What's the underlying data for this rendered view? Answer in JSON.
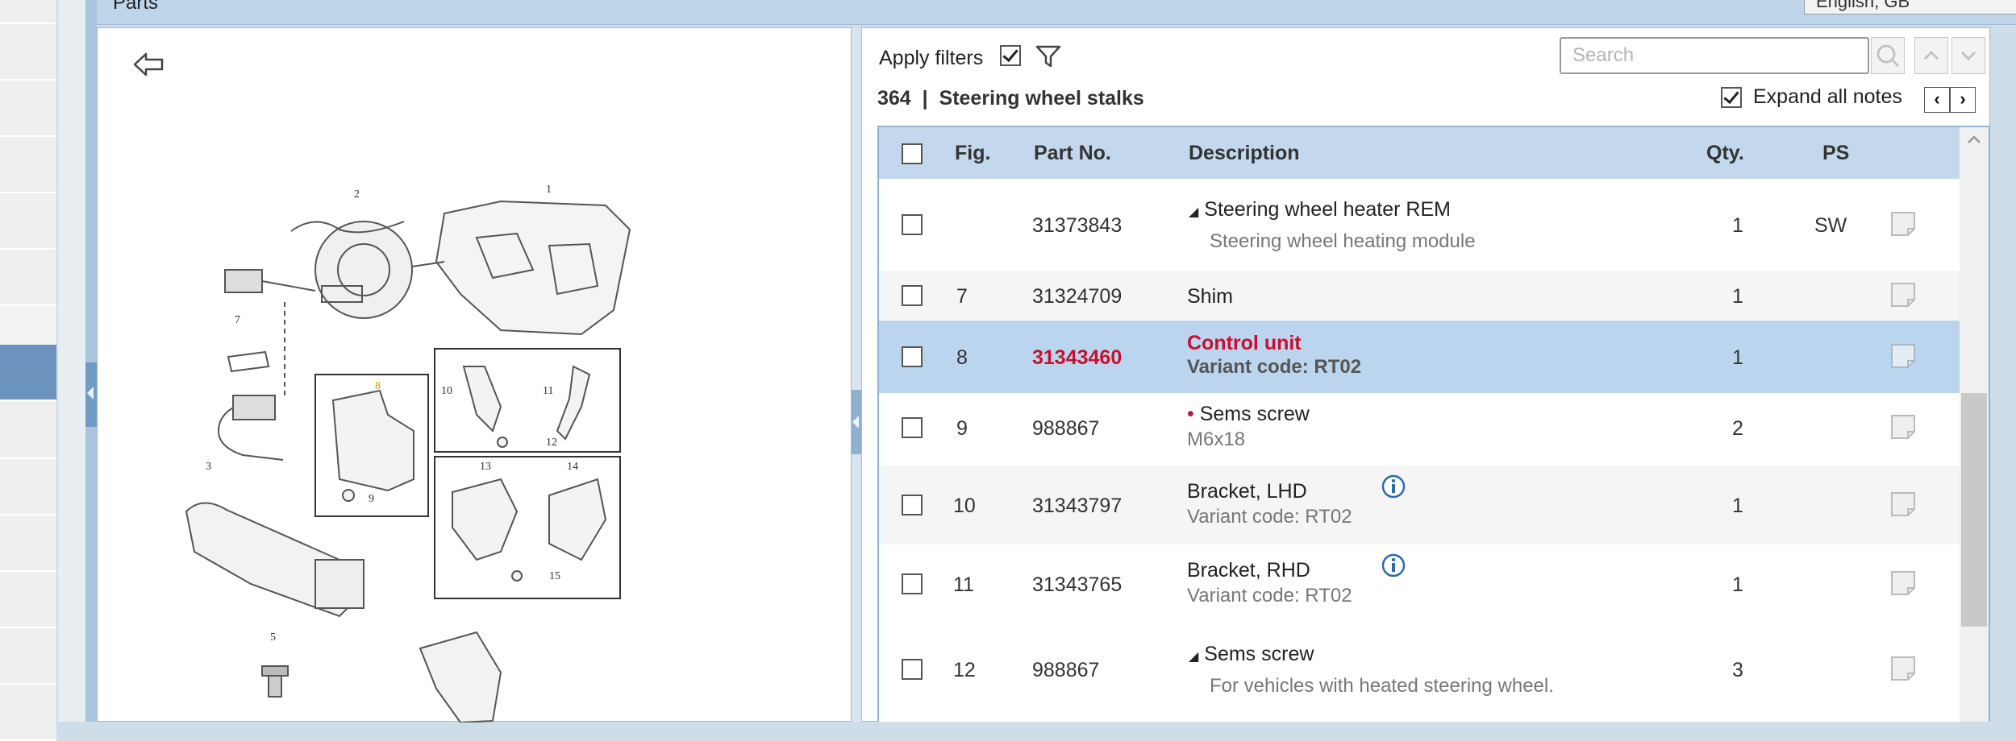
{
  "header": {
    "title": "Parts",
    "language": "English, GB"
  },
  "toolbar": {
    "apply_filters_label": "Apply filters",
    "apply_filters_checked": true,
    "search_placeholder": "Search",
    "section_number": "364",
    "section_separator": "|",
    "section_title": "Steering wheel stalks",
    "expand_all_notes_label": "Expand all notes",
    "expand_all_notes_checked": true,
    "prev_label": "‹",
    "next_label": "›"
  },
  "table": {
    "columns": {
      "fig": "Fig.",
      "part_no": "Part No.",
      "description": "Description",
      "qty": "Qty.",
      "ps": "PS"
    },
    "rows": [
      {
        "fig": "",
        "part_no": "31373843",
        "prefix": "◢",
        "description": "Steering wheel heater REM",
        "note": "Steering wheel heating module",
        "qty": "1",
        "ps": "SW"
      },
      {
        "fig": "7",
        "part_no": "31324709",
        "prefix": "",
        "description": "Shim",
        "note": "",
        "qty": "1",
        "ps": ""
      },
      {
        "fig": "8",
        "part_no": "31343460",
        "prefix": "",
        "description": "Control unit",
        "note": "Variant code: RT02",
        "qty": "1",
        "ps": "",
        "selected": true
      },
      {
        "fig": "9",
        "part_no": "988867",
        "prefix": "•",
        "description": "Sems screw",
        "note": "M6x18",
        "qty": "2",
        "ps": ""
      },
      {
        "fig": "10",
        "part_no": "31343797",
        "prefix": "",
        "description": "Bracket, LHD",
        "note": "Variant code: RT02",
        "qty": "1",
        "ps": "",
        "info": true
      },
      {
        "fig": "11",
        "part_no": "31343765",
        "prefix": "",
        "description": "Bracket, RHD",
        "note": "Variant code: RT02",
        "qty": "1",
        "ps": "",
        "info": true
      },
      {
        "fig": "12",
        "part_no": "988867",
        "prefix": "◢",
        "description": "Sems screw",
        "note": "For vehicles with heated steering wheel.",
        "qty": "3",
        "ps": ""
      }
    ]
  },
  "diagram": {
    "callouts": [
      "1",
      "2",
      "3",
      "5",
      "7",
      "8",
      "9",
      "10",
      "11",
      "12",
      "13",
      "14",
      "15"
    ]
  },
  "colors": {
    "accent": "#6b93bd",
    "selected_row": "#bcd5ee",
    "highlight_text": "#c8102e",
    "header_bar": "#bfd5ea"
  },
  "icons": [
    "back-arrow-icon",
    "filter-icon",
    "search-icon",
    "chevron-up-icon",
    "chevron-down-icon",
    "print-icon",
    "note-icon",
    "info-icon"
  ]
}
